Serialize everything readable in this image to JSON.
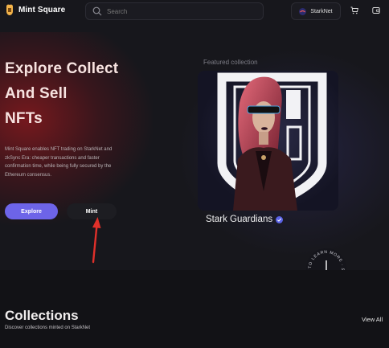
{
  "header": {
    "logo_text": "Mint Square",
    "search_placeholder": "Search",
    "network_label": "StarkNet"
  },
  "hero": {
    "title_lines": [
      "Explore Collect",
      "And Sell",
      "NFTs"
    ],
    "description": "Mint Square enables NFT trading on StarkNet and zkSync Era: cheaper transactions and faster confirmation time, while being fully secured by the Ethereum consensus.",
    "explore_label": "Explore",
    "mint_label": "Mint"
  },
  "featured": {
    "label": "Featured collection",
    "collection_name": "Stark Guardians",
    "learn_more_text": "TO LEARN MORE · SCROLL DOWN ·"
  },
  "collections": {
    "title": "Collections",
    "subtitle": "Discover collections minted on StarkNet",
    "view_all_label": "View All"
  },
  "colors": {
    "accent": "#6d64e8",
    "annotation_arrow": "#e0302a",
    "background": "#17171c"
  }
}
